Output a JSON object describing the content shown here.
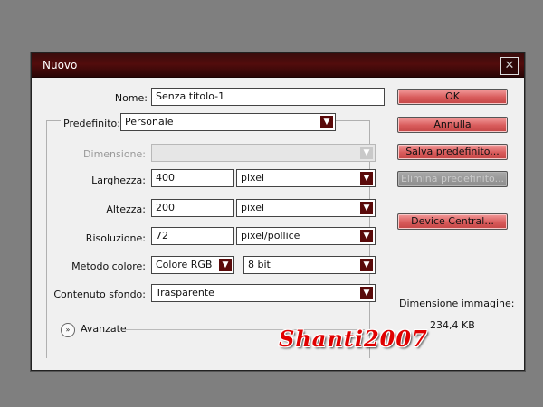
{
  "dialog": {
    "title": "Nuovo",
    "close_glyph": "✕",
    "name_label": "Nome:",
    "name_value": "Senza titolo-1",
    "preset_label": "Predefinito:",
    "preset_value": "Personale",
    "size_label": "Dimensione:",
    "size_value": "",
    "width_label": "Larghezza:",
    "width_value": "400",
    "width_unit": "pixel",
    "height_label": "Altezza:",
    "height_value": "200",
    "height_unit": "pixel",
    "resolution_label": "Risoluzione:",
    "resolution_value": "72",
    "resolution_unit": "pixel/pollice",
    "color_mode_label": "Metodo colore:",
    "color_mode_value": "Colore RGB",
    "bit_depth_value": "8 bit",
    "background_label": "Contenuto sfondo:",
    "background_value": "Trasparente",
    "advanced_label": "Avanzate",
    "buttons": {
      "ok": "OK",
      "cancel": "Annulla",
      "save_preset": "Salva predefinito...",
      "delete_preset": "Elimina predefinito...",
      "device_central": "Device Central..."
    },
    "image_size_label": "Dimensione immagine:",
    "image_size_value": "234,4 KB"
  },
  "watermark": "Shanti2007",
  "icons": {
    "dropdown": "chevron-down-icon",
    "expand": "double-chevron-down-icon",
    "close": "close-icon"
  },
  "colors": {
    "titlebar": "#520c0c",
    "button": "#d85b5b",
    "watermark": "#e00000"
  }
}
